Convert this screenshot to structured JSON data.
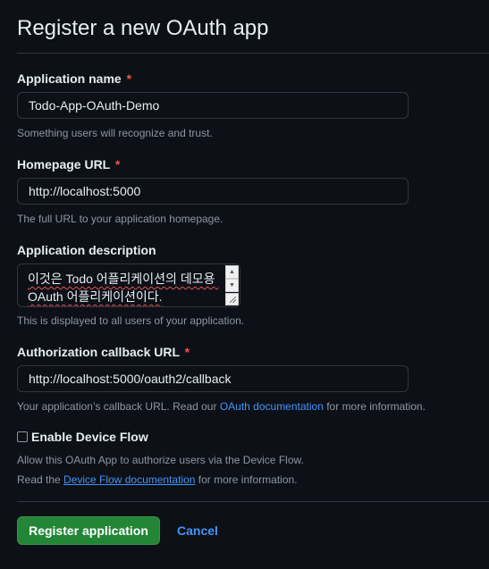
{
  "page": {
    "title": "Register a new OAuth app"
  },
  "form": {
    "app_name": {
      "label": "Application name",
      "required_mark": "*",
      "value": "Todo-App-OAuth-Demo",
      "hint": "Something users will recognize and trust."
    },
    "homepage_url": {
      "label": "Homepage URL",
      "required_mark": "*",
      "value": "http://localhost:5000",
      "hint": "The full URL to your application homepage."
    },
    "description": {
      "label": "Application description",
      "value": "이것은 Todo 어플리케이션의 데모용 OAuth 어플리케이션이다.",
      "hint": "This is displayed to all users of your application."
    },
    "callback_url": {
      "label": "Authorization callback URL",
      "required_mark": "*",
      "value": "http://localhost:5000/oauth2/callback",
      "hint_prefix": "Your application’s callback URL. Read our ",
      "hint_link": "OAuth documentation",
      "hint_suffix": " for more information."
    },
    "device_flow": {
      "label": "Enable Device Flow",
      "checked": false,
      "hint_line1": "Allow this OAuth App to authorize users via the Device Flow.",
      "hint_line2_prefix": "Read the ",
      "hint_line2_link": "Device Flow documentation",
      "hint_line2_suffix": " for more information."
    }
  },
  "actions": {
    "register_label": "Register application",
    "cancel_label": "Cancel"
  },
  "icons": {
    "scroll_up": "triangle-up-icon",
    "scroll_down": "triangle-down-icon",
    "resize": "resize-grip-icon"
  },
  "colors": {
    "background": "#0d1117",
    "text": "#e6edf3",
    "muted": "#8d96a0",
    "required": "#f85149",
    "link": "#4493f8",
    "primary_button": "#238636",
    "border": "#30363d"
  }
}
